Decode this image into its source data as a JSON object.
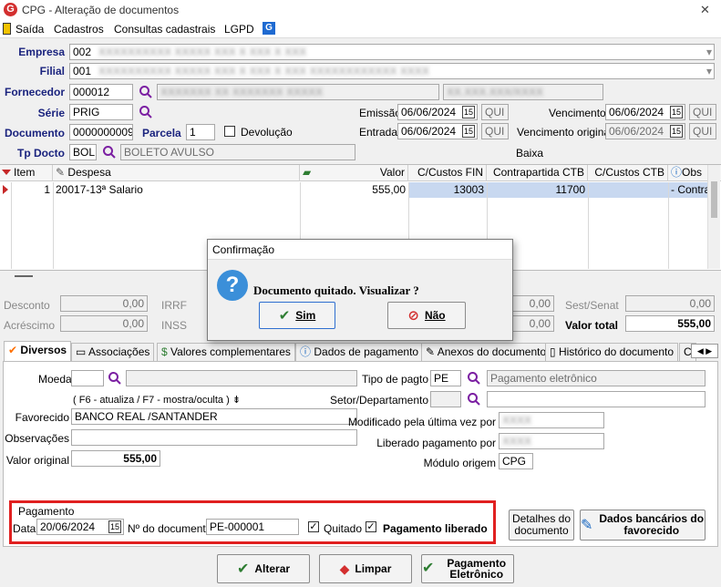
{
  "window": {
    "title": "CPG - Alteração de documentos",
    "close": "✕"
  },
  "menu": [
    "Saída",
    "Cadastros",
    "Consultas cadastrais",
    "LGPD"
  ],
  "header": {
    "empresa_label": "Empresa",
    "empresa_value": "002",
    "filial_label": "Filial",
    "filial_value": "001",
    "fornecedor_label": "Fornecedor",
    "fornecedor_value": "000012",
    "serie_label": "Série",
    "serie_value": "PRIG",
    "documento_label": "Documento",
    "documento_value": "0000000009",
    "parcela_label": "Parcela",
    "parcela_value": "1",
    "devolucao_label": "Devolução",
    "tpdocto_label": "Tp Docto",
    "tpdocto_value": "BOL",
    "tpdocto_desc": "BOLETO AVULSO",
    "emissao_label": "Emissão",
    "emissao_value": "06/06/2024",
    "emissao_week": "QUI",
    "entrada_label": "Entrada",
    "entrada_value": "06/06/2024",
    "entrada_week": "QUI",
    "vencimento_label": "Vencimento",
    "vencimento_value": "06/06/2024",
    "vencimento_week": "QUI",
    "vencorig_label": "Vencimento original",
    "vencorig_value": "06/06/2024",
    "vencorig_week": "QUI",
    "baixa_label": "Baixa"
  },
  "grid": {
    "columns": [
      "Item",
      "Despesa",
      "Valor",
      "C/Custos FIN",
      "Contrapartida CTB",
      "C/Custos CTB",
      "Obs"
    ],
    "rows": [
      {
        "item": "1",
        "despesa": "20017-13ª Salario",
        "valor": "555,00",
        "ccfin": "13003",
        "contrap": "11700",
        "ccctb": "",
        "obs": "- Contra"
      }
    ]
  },
  "totals": {
    "desconto_label": "Desconto",
    "desconto_value": "0,00",
    "acrescimo_label": "Acréscimo",
    "acrescimo_value": "0,00",
    "irrf_label": "IRRF",
    "inss_label": "INSS",
    "r1": "0,00",
    "r2": "0,00",
    "sestsenat_label": "Sest/Senat",
    "sestsenat_value": "0,00",
    "valortotal_label": "Valor total",
    "valortotal_value": "555,00"
  },
  "tabs": [
    "Diversos",
    "Associações",
    "Valores complementares",
    "Dados de pagamento",
    "Anexos do documento",
    "Histórico do documento",
    "C"
  ],
  "diversos": {
    "moeda_label": "Moeda",
    "hint": "( F6 - atualiza / F7 - mostra/oculta )",
    "favorecido_label": "Favorecido",
    "favorecido_value": "BANCO REAL /SANTANDER",
    "observacoes_label": "Observações",
    "valororiginal_label": "Valor original",
    "valororiginal_value": "555,00",
    "tipopagto_label": "Tipo de pagto",
    "tipopagto_value": "PE",
    "tipopagto_desc": "Pagamento eletrônico",
    "setor_label": "Setor/Departamento",
    "modificado_label": "Modificado pela última vez por",
    "liberado_label": "Liberado pagamento por",
    "modulo_label": "Módulo origem",
    "modulo_value": "CPG"
  },
  "pagamento": {
    "group_label": "Pagamento",
    "data_label": "Data",
    "data_value": "20/06/2024",
    "ndoc_label": "Nº do documento",
    "ndoc_value": "PE-000001",
    "quitado_label": "Quitado",
    "liberado_label": "Pagamento liberado"
  },
  "buttons": {
    "detalhes": "Detalhes do documento",
    "dados_bancarios": "Dados bancários do favorecido",
    "alterar": "Alterar",
    "limpar": "Limpar",
    "pag_eletronico": "Pagamento Eletrônico"
  },
  "dialog": {
    "title": "Confirmação",
    "message": "Documento quitado. Visualizar ?",
    "yes": "Sim",
    "no": "Não"
  },
  "colors": {
    "highlight_red": "#e02020",
    "selection": "#c8d8f0",
    "label_blue": "#1a237e"
  }
}
